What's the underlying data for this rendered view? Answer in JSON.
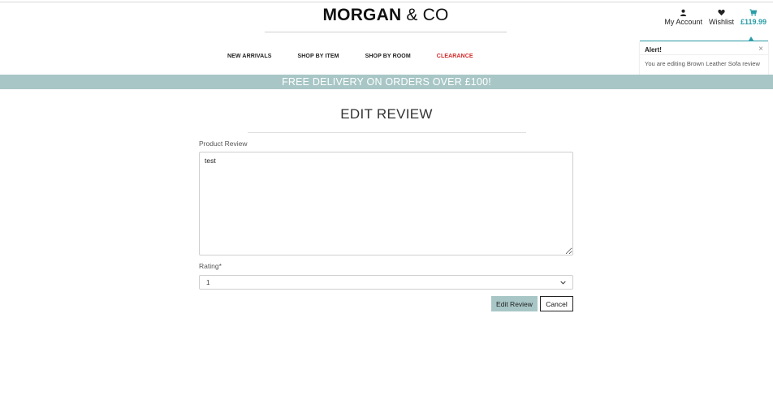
{
  "brand": {
    "name_bold": "MORGAN",
    "name_rest": " & CO"
  },
  "account_nav": {
    "my_account": {
      "label": "My Account",
      "icon": "user-icon"
    },
    "wishlist": {
      "label": "Wishlist",
      "icon": "heart-icon"
    },
    "cart": {
      "label": "£119.99",
      "icon": "cart-icon"
    }
  },
  "main_nav": [
    {
      "label": "NEW ARRIVALS"
    },
    {
      "label": "SHOP BY ITEM"
    },
    {
      "label": "SHOP BY ROOM"
    },
    {
      "label": "CLEARANCE"
    }
  ],
  "banner": {
    "text": "FREE DELIVERY ON ORDERS OVER £100!"
  },
  "toast": {
    "title": "Alert!",
    "close": "×",
    "message": "You are editing Brown Leather Sofa review"
  },
  "page": {
    "title": "EDIT REVIEW"
  },
  "form": {
    "review_label": "Product Review",
    "review_value": "test",
    "rating_label": "Rating*",
    "rating_value": "1",
    "submit_label": "Edit Review",
    "cancel_label": "Cancel"
  },
  "colors": {
    "accent": "#2a9da7",
    "banner": "#a8c6c6",
    "clearance": "#d42a2a"
  }
}
